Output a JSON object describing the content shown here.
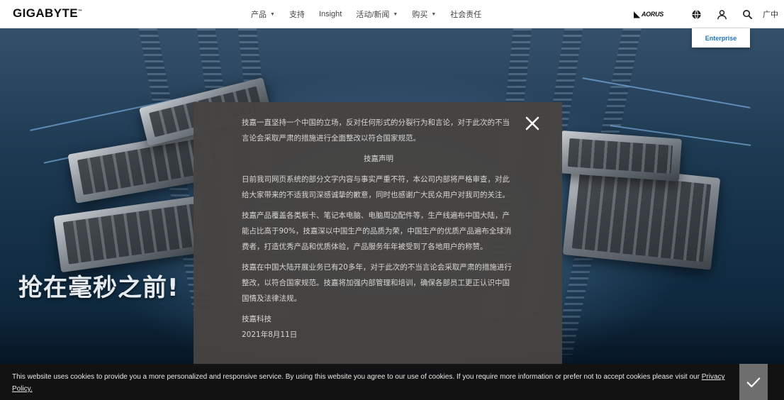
{
  "brand": {
    "logo_text": "GIGABYTE",
    "tm": "™"
  },
  "nav": {
    "items": [
      {
        "label": "产品",
        "dropdown": true
      },
      {
        "label": "支持",
        "dropdown": false
      },
      {
        "label": "Insight",
        "dropdown": false
      },
      {
        "label": "活动/新闻",
        "dropdown": true
      },
      {
        "label": "购买",
        "dropdown": true
      },
      {
        "label": "社会责任",
        "dropdown": false
      }
    ],
    "aorus_label": "AORUS",
    "icons": [
      "globe-icon",
      "user-icon",
      "search-icon"
    ],
    "language": "广中",
    "enterprise_label": "Enterprise"
  },
  "hero": {
    "slogan": "抢在毫秒之前!"
  },
  "modal": {
    "paragraphs": [
      "技嘉一直坚持一个中国的立场，反对任何形式的分裂行为和言论，对于此次的不当言论会采取严肃的措施进行全面整改以符合国家规范。",
      "技嘉声明",
      "日前我司网页系统的部分文字内容与事实严重不符，本公司内部将严格审查，对此给大家带来的不适我司深感诚挚的歉意，同时也感谢广大民众用户对我司的关注。",
      "技嘉产品覆盖各类板卡、笔记本电脑、电脑周边配件等，生产线遍布中国大陆，产能占比高于90%，技嘉深以中国生产的品质为荣，中国生产的优质产品遍布全球消费者，打造优秀产品和优质体验，产品服务年年被受到了各地用户的称赞。",
      "技嘉在中国大陆开展业务已有20多年，对于此次的不当言论会采取严肃的措施进行整改，以符合国家规范。技嘉将加强内部管理和培训，确保各部员工更正认识中国国情及法律法规。",
      "技嘉科技",
      "2021年8月11日"
    ],
    "close_symbol": "✕"
  },
  "cookie": {
    "text": "This website uses cookies to provide you a more personalized and responsive service. By using this website you agree to our use of cookies. If you require more information or prefer not to accept cookies please visit our ",
    "link_text": "Privacy Policy."
  },
  "colors": {
    "accent": "#1a73c8",
    "modal_bg": "#464442",
    "cookie_bg": "#141212"
  }
}
